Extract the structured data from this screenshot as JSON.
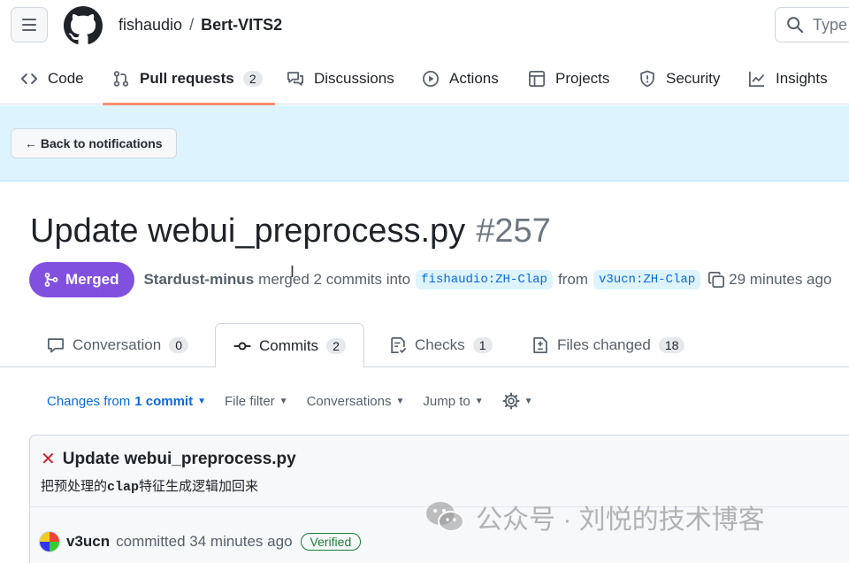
{
  "header": {
    "owner": "fishaudio",
    "separator": "/",
    "repo": "Bert-VITS2",
    "search_placeholder": "Type"
  },
  "repo_nav": {
    "items": [
      {
        "label": "Code",
        "icon": "code-icon"
      },
      {
        "label": "Pull requests",
        "count": "2",
        "icon": "pull-request-icon",
        "active": true
      },
      {
        "label": "Discussions",
        "icon": "discussions-icon"
      },
      {
        "label": "Actions",
        "icon": "actions-icon"
      },
      {
        "label": "Projects",
        "icon": "projects-icon"
      },
      {
        "label": "Security",
        "icon": "shield-icon"
      },
      {
        "label": "Insights",
        "icon": "graph-icon"
      }
    ]
  },
  "banner": {
    "back_label": "← Back to notifications"
  },
  "pr": {
    "title": "Update webui_preprocess.py",
    "number": "#257",
    "state": "Merged",
    "author": "Stardust-minus",
    "action_text": "merged 2 commits into",
    "base_branch": "fishaudio:ZH-Clap",
    "from_text": "from",
    "head_branch": "v3ucn:ZH-Clap",
    "time": "29 minutes ago"
  },
  "tabs": [
    {
      "label": "Conversation",
      "count": "0",
      "icon": "comment-icon"
    },
    {
      "label": "Commits",
      "count": "2",
      "icon": "commit-icon",
      "active": true
    },
    {
      "label": "Checks",
      "count": "1",
      "icon": "checklist-icon"
    },
    {
      "label": "Files changed",
      "count": "18",
      "icon": "file-diff-icon"
    }
  ],
  "toolbar": {
    "changes_prefix": "Changes from",
    "changes_value": "1 commit",
    "file_filter": "File filter",
    "conversations": "Conversations",
    "jump_to": "Jump to"
  },
  "commit": {
    "title": "Update webui_preprocess.py",
    "msg_before": "把预处理的",
    "msg_mono": "clap",
    "msg_after": "特征生成逻辑加回来",
    "author": "v3ucn",
    "committed_text": "committed 34 minutes ago",
    "verified": "Verified"
  },
  "watermark": {
    "text": "公众号 · 刘悦的技术博客"
  },
  "colors": {
    "merged": "#8250df",
    "link": "#0969da",
    "banner": "#ddf4ff",
    "active_underline": "#fd8c73",
    "error": "#cf222e",
    "verified": "#1a7f37"
  }
}
